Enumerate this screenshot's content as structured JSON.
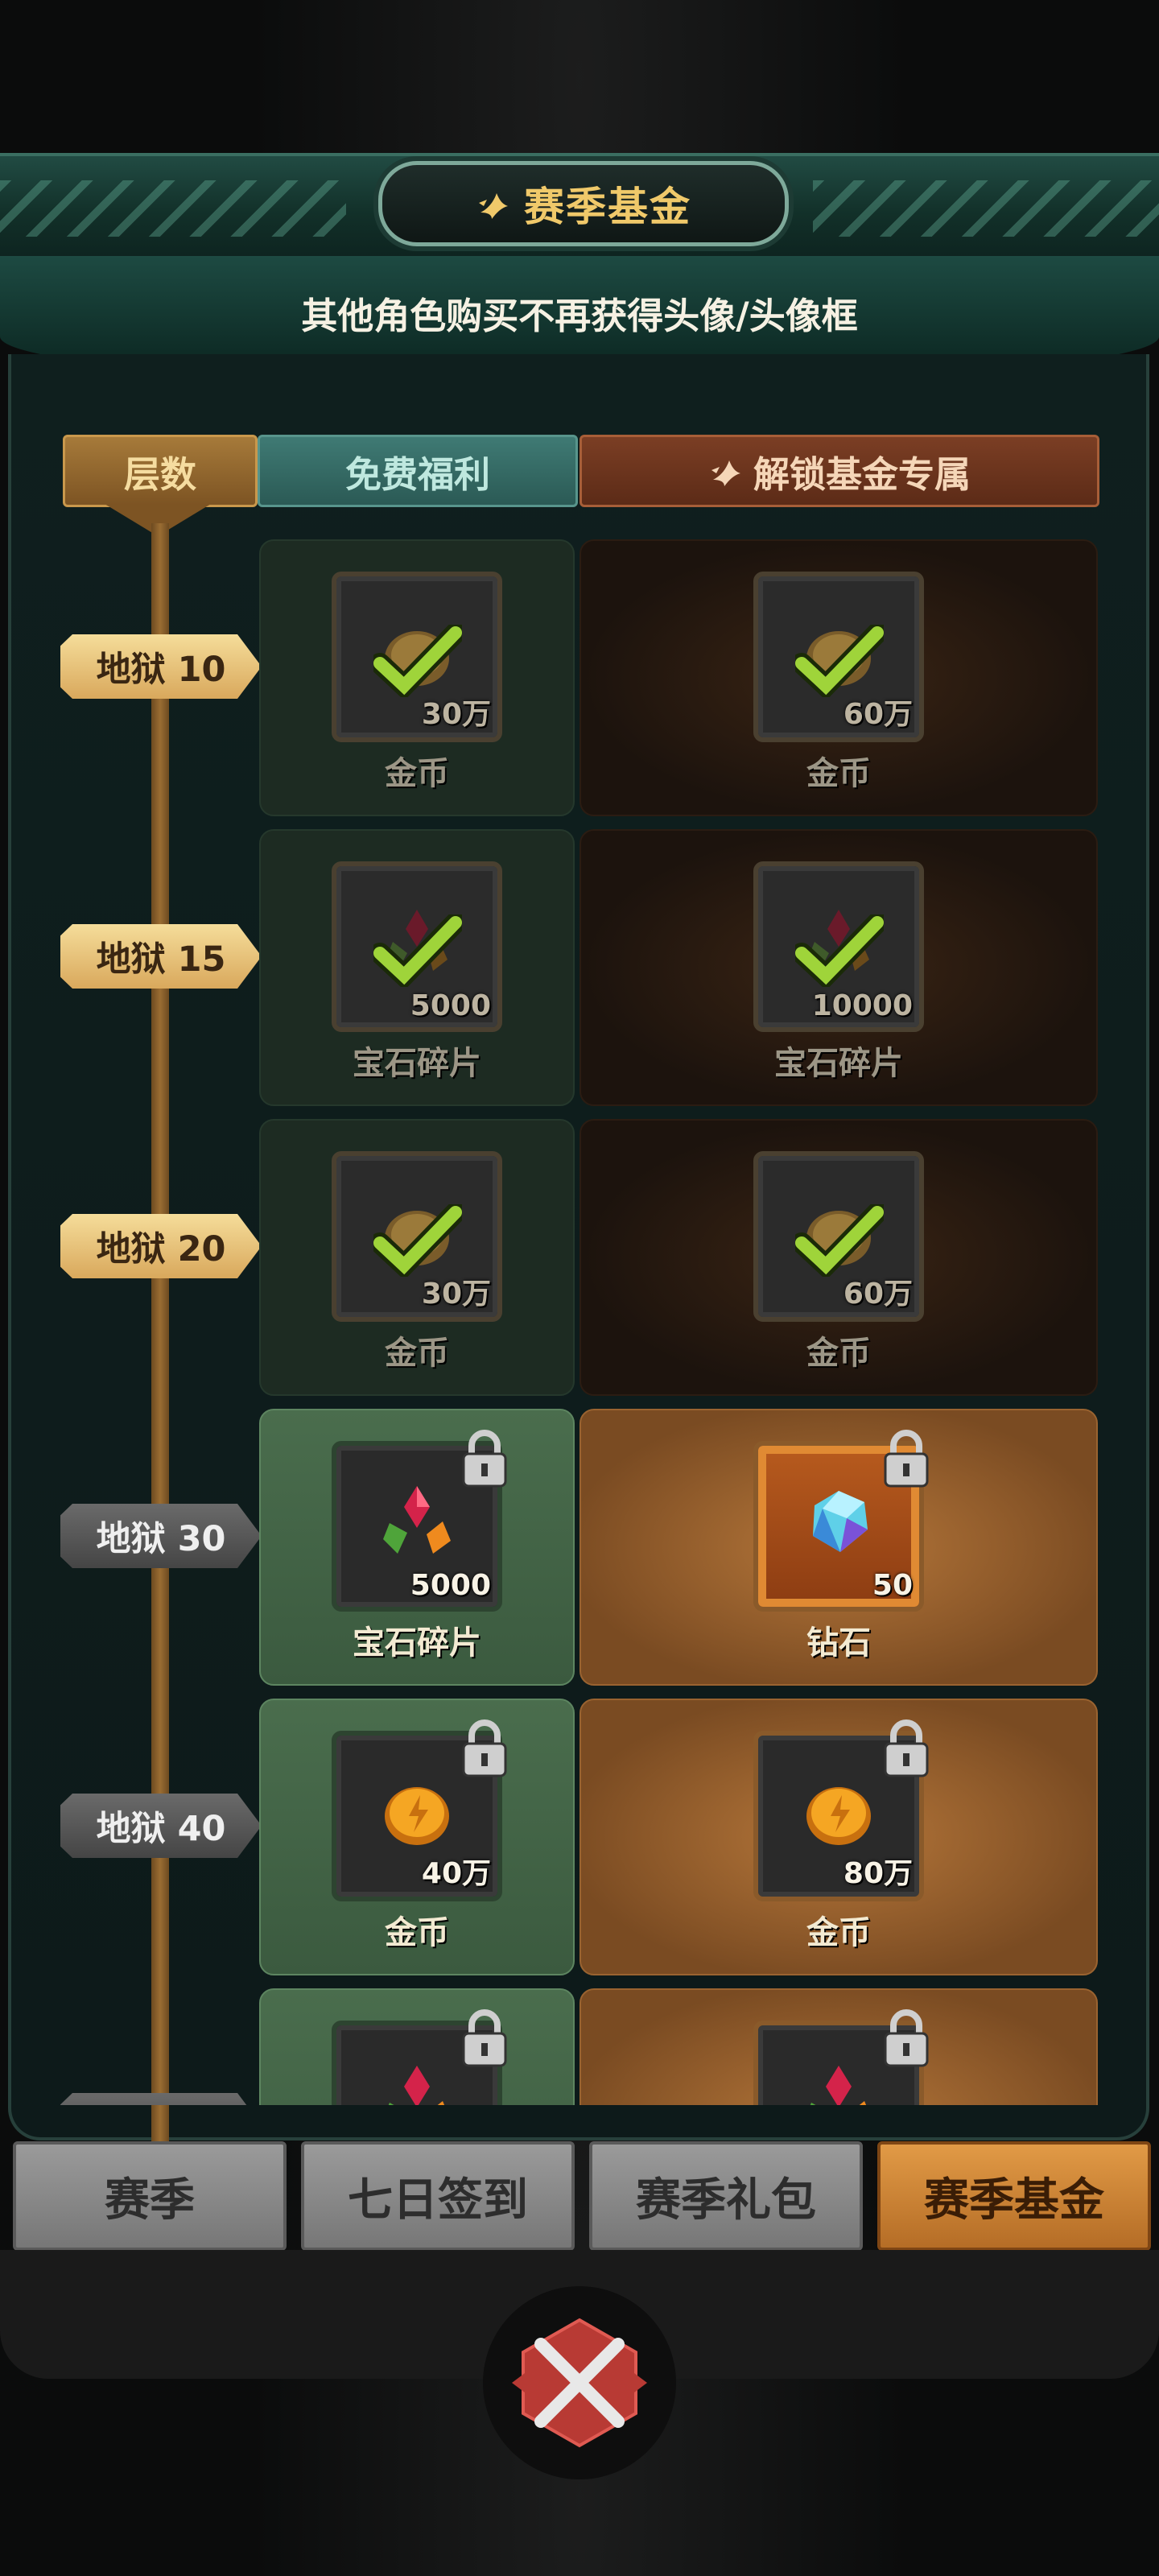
{
  "header": {
    "title": "赛季基金",
    "subtitle": "其他角色购买不再获得头像/头像框"
  },
  "columns": {
    "floor": "层数",
    "free": "免费福利",
    "paid": "解锁基金专属"
  },
  "rows": [
    {
      "floor": "地狱 10",
      "free": {
        "qty": "30万",
        "name": "金币",
        "icon": "gold-coin-icon"
      },
      "paid": {
        "qty": "60万",
        "name": "金币",
        "icon": "gold-coin-icon"
      },
      "status": "claimed"
    },
    {
      "floor": "地狱 15",
      "free": {
        "qty": "5000",
        "name": "宝石碎片",
        "icon": "gem-shards-icon"
      },
      "paid": {
        "qty": "10000",
        "name": "宝石碎片",
        "icon": "gem-shards-icon"
      },
      "status": "claimed"
    },
    {
      "floor": "地狱 20",
      "free": {
        "qty": "30万",
        "name": "金币",
        "icon": "gold-coin-icon"
      },
      "paid": {
        "qty": "60万",
        "name": "金币",
        "icon": "gold-coin-icon"
      },
      "status": "claimed"
    },
    {
      "floor": "地狱 30",
      "free": {
        "qty": "5000",
        "name": "宝石碎片",
        "icon": "gem-shards-icon"
      },
      "paid": {
        "qty": "50",
        "name": "钻石",
        "icon": "diamond-icon"
      },
      "status": "locked"
    },
    {
      "floor": "地狱 40",
      "free": {
        "qty": "40万",
        "name": "金币",
        "icon": "gold-coin-icon"
      },
      "paid": {
        "qty": "80万",
        "name": "金币",
        "icon": "gold-coin-icon"
      },
      "status": "locked"
    }
  ],
  "tabs": [
    "赛季",
    "七日签到",
    "赛季礼包",
    "赛季基金"
  ],
  "active_tab": "赛季基金",
  "colors": {
    "accent_gold": "#f0c96a",
    "free_column": "#3f7a74",
    "paid_column": "#7b3e24",
    "active_tab": "#e19a46"
  }
}
